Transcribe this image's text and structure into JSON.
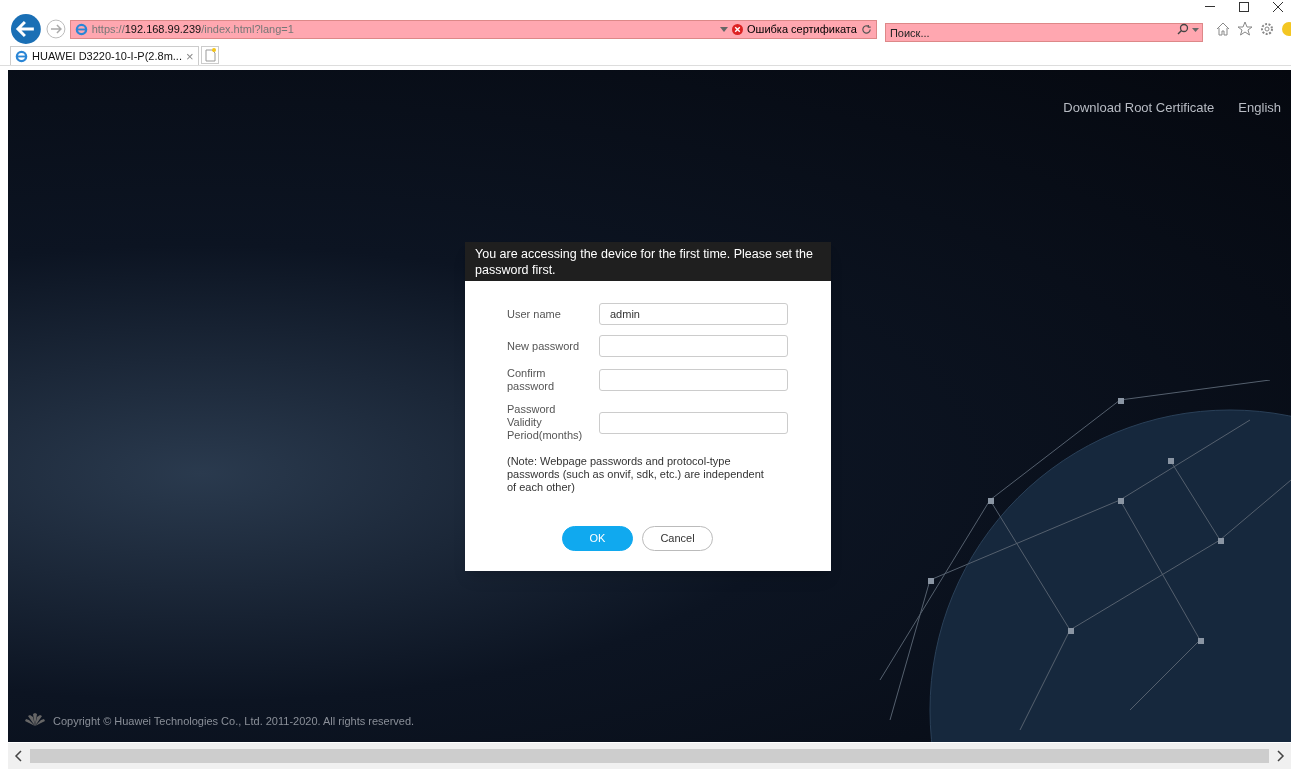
{
  "browser": {
    "address": {
      "scheme": "https://",
      "host": "192.168.99.239",
      "path": "/index.html?lang=1"
    },
    "cert_error": "Ошибка сертификата",
    "search": {
      "placeholder": "Поиск..."
    },
    "tabs": [
      {
        "title": "HUAWEI D3220-10-I-P(2.8m...",
        "close": "×",
        "selected": true
      }
    ]
  },
  "header_links": [
    "Download Root Certificate",
    "English"
  ],
  "dialog": {
    "title": "You are accessing the device for the first time. Please set the password first.",
    "fields": [
      {
        "label": "User name",
        "value": "admin"
      },
      {
        "label": "New password"
      },
      {
        "label": "Confirm password"
      },
      {
        "label": "Password Validity Period(months)"
      }
    ],
    "note": "(Note: Webpage passwords and protocol-type passwords (such as onvif, sdk, etc.) are independent of each other)",
    "buttons": [
      {
        "kind": "primary",
        "label": "OK"
      },
      {
        "kind": "secondary",
        "label": "Cancel"
      }
    ]
  },
  "footer": {
    "copyright": "Copyright © Huawei Technologies Co., Ltd. 2011-2020. All rights reserved."
  }
}
